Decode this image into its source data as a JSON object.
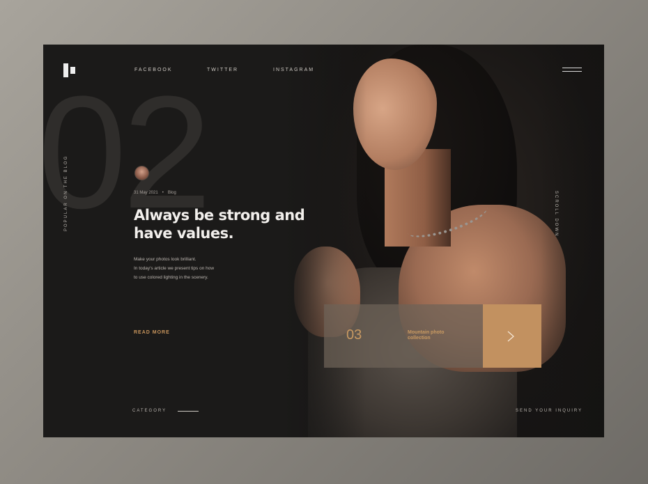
{
  "big_number": "02",
  "nav": {
    "facebook": "FACEBOOK",
    "twitter": "TWITTER",
    "instagram": "INSTAGRAM"
  },
  "side_left_label": "POPULAR ON THE BLOG",
  "side_right_label": "SCROLL DOWN",
  "post": {
    "date": "31 May 2021",
    "category": "Blog",
    "title_line1": "Always be strong and",
    "title_line2": "have values.",
    "desc_line1": "Make your photos look brilliant.",
    "desc_line2": "In today's article we present tips on how",
    "desc_line3": "to use colored lighting in the scenery.",
    "read_more": "READ MORE"
  },
  "footer": {
    "category": "CATEGORY",
    "inquiry": "SEND YOUR INQUIRY"
  },
  "slide_card": {
    "number": "03",
    "title_line1": "Mountain photo",
    "title_line2": "collection"
  },
  "icons": {
    "logo": "logo-icon",
    "menu": "hamburger-menu-icon",
    "next": "chevron-right-icon"
  },
  "colors": {
    "background": "#1b1a19",
    "accent": "#c29160",
    "text": "#f2efec"
  }
}
